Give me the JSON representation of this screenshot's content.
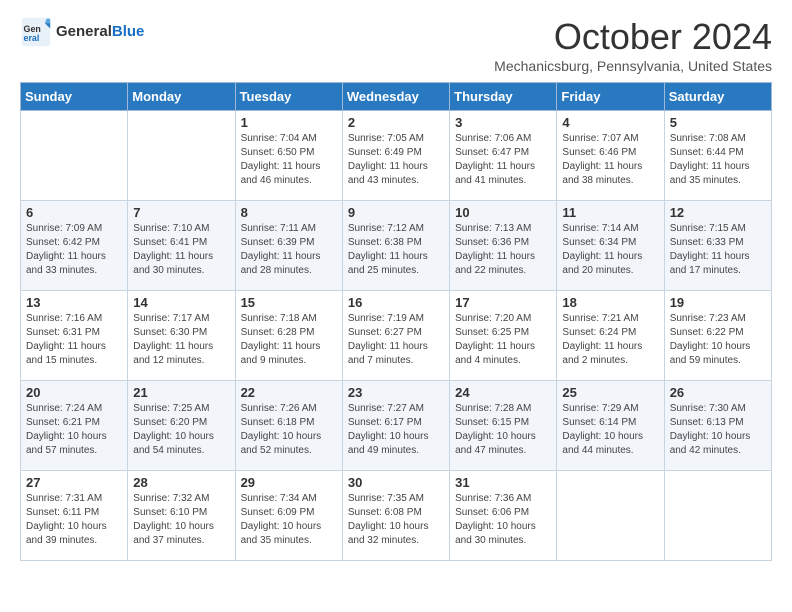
{
  "header": {
    "logo_general": "General",
    "logo_blue": "Blue",
    "month_title": "October 2024",
    "location": "Mechanicsburg, Pennsylvania, United States"
  },
  "days_of_week": [
    "Sunday",
    "Monday",
    "Tuesday",
    "Wednesday",
    "Thursday",
    "Friday",
    "Saturday"
  ],
  "weeks": [
    [
      {
        "day": "",
        "sunrise": "",
        "sunset": "",
        "daylight": ""
      },
      {
        "day": "",
        "sunrise": "",
        "sunset": "",
        "daylight": ""
      },
      {
        "day": "1",
        "sunrise": "Sunrise: 7:04 AM",
        "sunset": "Sunset: 6:50 PM",
        "daylight": "Daylight: 11 hours and 46 minutes."
      },
      {
        "day": "2",
        "sunrise": "Sunrise: 7:05 AM",
        "sunset": "Sunset: 6:49 PM",
        "daylight": "Daylight: 11 hours and 43 minutes."
      },
      {
        "day": "3",
        "sunrise": "Sunrise: 7:06 AM",
        "sunset": "Sunset: 6:47 PM",
        "daylight": "Daylight: 11 hours and 41 minutes."
      },
      {
        "day": "4",
        "sunrise": "Sunrise: 7:07 AM",
        "sunset": "Sunset: 6:46 PM",
        "daylight": "Daylight: 11 hours and 38 minutes."
      },
      {
        "day": "5",
        "sunrise": "Sunrise: 7:08 AM",
        "sunset": "Sunset: 6:44 PM",
        "daylight": "Daylight: 11 hours and 35 minutes."
      }
    ],
    [
      {
        "day": "6",
        "sunrise": "Sunrise: 7:09 AM",
        "sunset": "Sunset: 6:42 PM",
        "daylight": "Daylight: 11 hours and 33 minutes."
      },
      {
        "day": "7",
        "sunrise": "Sunrise: 7:10 AM",
        "sunset": "Sunset: 6:41 PM",
        "daylight": "Daylight: 11 hours and 30 minutes."
      },
      {
        "day": "8",
        "sunrise": "Sunrise: 7:11 AM",
        "sunset": "Sunset: 6:39 PM",
        "daylight": "Daylight: 11 hours and 28 minutes."
      },
      {
        "day": "9",
        "sunrise": "Sunrise: 7:12 AM",
        "sunset": "Sunset: 6:38 PM",
        "daylight": "Daylight: 11 hours and 25 minutes."
      },
      {
        "day": "10",
        "sunrise": "Sunrise: 7:13 AM",
        "sunset": "Sunset: 6:36 PM",
        "daylight": "Daylight: 11 hours and 22 minutes."
      },
      {
        "day": "11",
        "sunrise": "Sunrise: 7:14 AM",
        "sunset": "Sunset: 6:34 PM",
        "daylight": "Daylight: 11 hours and 20 minutes."
      },
      {
        "day": "12",
        "sunrise": "Sunrise: 7:15 AM",
        "sunset": "Sunset: 6:33 PM",
        "daylight": "Daylight: 11 hours and 17 minutes."
      }
    ],
    [
      {
        "day": "13",
        "sunrise": "Sunrise: 7:16 AM",
        "sunset": "Sunset: 6:31 PM",
        "daylight": "Daylight: 11 hours and 15 minutes."
      },
      {
        "day": "14",
        "sunrise": "Sunrise: 7:17 AM",
        "sunset": "Sunset: 6:30 PM",
        "daylight": "Daylight: 11 hours and 12 minutes."
      },
      {
        "day": "15",
        "sunrise": "Sunrise: 7:18 AM",
        "sunset": "Sunset: 6:28 PM",
        "daylight": "Daylight: 11 hours and 9 minutes."
      },
      {
        "day": "16",
        "sunrise": "Sunrise: 7:19 AM",
        "sunset": "Sunset: 6:27 PM",
        "daylight": "Daylight: 11 hours and 7 minutes."
      },
      {
        "day": "17",
        "sunrise": "Sunrise: 7:20 AM",
        "sunset": "Sunset: 6:25 PM",
        "daylight": "Daylight: 11 hours and 4 minutes."
      },
      {
        "day": "18",
        "sunrise": "Sunrise: 7:21 AM",
        "sunset": "Sunset: 6:24 PM",
        "daylight": "Daylight: 11 hours and 2 minutes."
      },
      {
        "day": "19",
        "sunrise": "Sunrise: 7:23 AM",
        "sunset": "Sunset: 6:22 PM",
        "daylight": "Daylight: 10 hours and 59 minutes."
      }
    ],
    [
      {
        "day": "20",
        "sunrise": "Sunrise: 7:24 AM",
        "sunset": "Sunset: 6:21 PM",
        "daylight": "Daylight: 10 hours and 57 minutes."
      },
      {
        "day": "21",
        "sunrise": "Sunrise: 7:25 AM",
        "sunset": "Sunset: 6:20 PM",
        "daylight": "Daylight: 10 hours and 54 minutes."
      },
      {
        "day": "22",
        "sunrise": "Sunrise: 7:26 AM",
        "sunset": "Sunset: 6:18 PM",
        "daylight": "Daylight: 10 hours and 52 minutes."
      },
      {
        "day": "23",
        "sunrise": "Sunrise: 7:27 AM",
        "sunset": "Sunset: 6:17 PM",
        "daylight": "Daylight: 10 hours and 49 minutes."
      },
      {
        "day": "24",
        "sunrise": "Sunrise: 7:28 AM",
        "sunset": "Sunset: 6:15 PM",
        "daylight": "Daylight: 10 hours and 47 minutes."
      },
      {
        "day": "25",
        "sunrise": "Sunrise: 7:29 AM",
        "sunset": "Sunset: 6:14 PM",
        "daylight": "Daylight: 10 hours and 44 minutes."
      },
      {
        "day": "26",
        "sunrise": "Sunrise: 7:30 AM",
        "sunset": "Sunset: 6:13 PM",
        "daylight": "Daylight: 10 hours and 42 minutes."
      }
    ],
    [
      {
        "day": "27",
        "sunrise": "Sunrise: 7:31 AM",
        "sunset": "Sunset: 6:11 PM",
        "daylight": "Daylight: 10 hours and 39 minutes."
      },
      {
        "day": "28",
        "sunrise": "Sunrise: 7:32 AM",
        "sunset": "Sunset: 6:10 PM",
        "daylight": "Daylight: 10 hours and 37 minutes."
      },
      {
        "day": "29",
        "sunrise": "Sunrise: 7:34 AM",
        "sunset": "Sunset: 6:09 PM",
        "daylight": "Daylight: 10 hours and 35 minutes."
      },
      {
        "day": "30",
        "sunrise": "Sunrise: 7:35 AM",
        "sunset": "Sunset: 6:08 PM",
        "daylight": "Daylight: 10 hours and 32 minutes."
      },
      {
        "day": "31",
        "sunrise": "Sunrise: 7:36 AM",
        "sunset": "Sunset: 6:06 PM",
        "daylight": "Daylight: 10 hours and 30 minutes."
      },
      {
        "day": "",
        "sunrise": "",
        "sunset": "",
        "daylight": ""
      },
      {
        "day": "",
        "sunrise": "",
        "sunset": "",
        "daylight": ""
      }
    ]
  ]
}
